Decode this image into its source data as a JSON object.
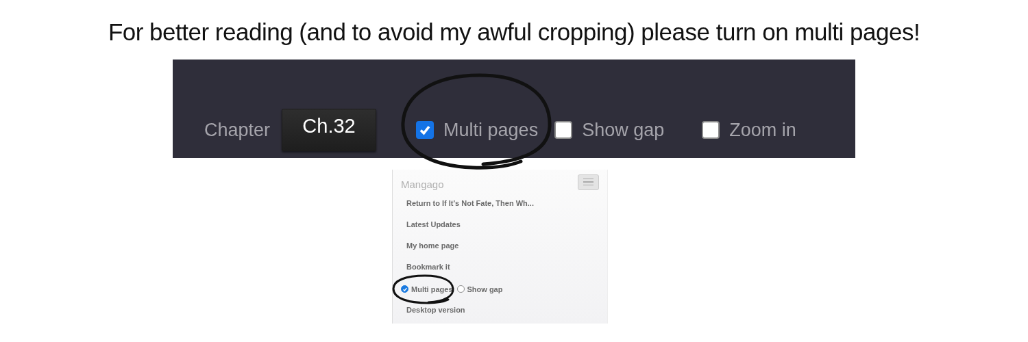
{
  "caption": "For better reading (and to avoid my awful cropping) please turn on multi pages!",
  "toolbar": {
    "chapter_label": "Chapter",
    "chapter_button": "Ch.32",
    "options": [
      {
        "label": "Multi pages",
        "checked": true
      },
      {
        "label": "Show gap",
        "checked": false
      },
      {
        "label": "Zoom in",
        "checked": false
      }
    ]
  },
  "mobile_menu": {
    "brand": "Mangago",
    "items": [
      "Return to If It's Not Fate, Then Wh...",
      "Latest Updates",
      "My home page",
      "Bookmark it"
    ],
    "options": [
      {
        "label": "Multi pages",
        "checked": true
      },
      {
        "label": "Show gap",
        "checked": false
      }
    ],
    "footer_link": "Desktop version"
  }
}
